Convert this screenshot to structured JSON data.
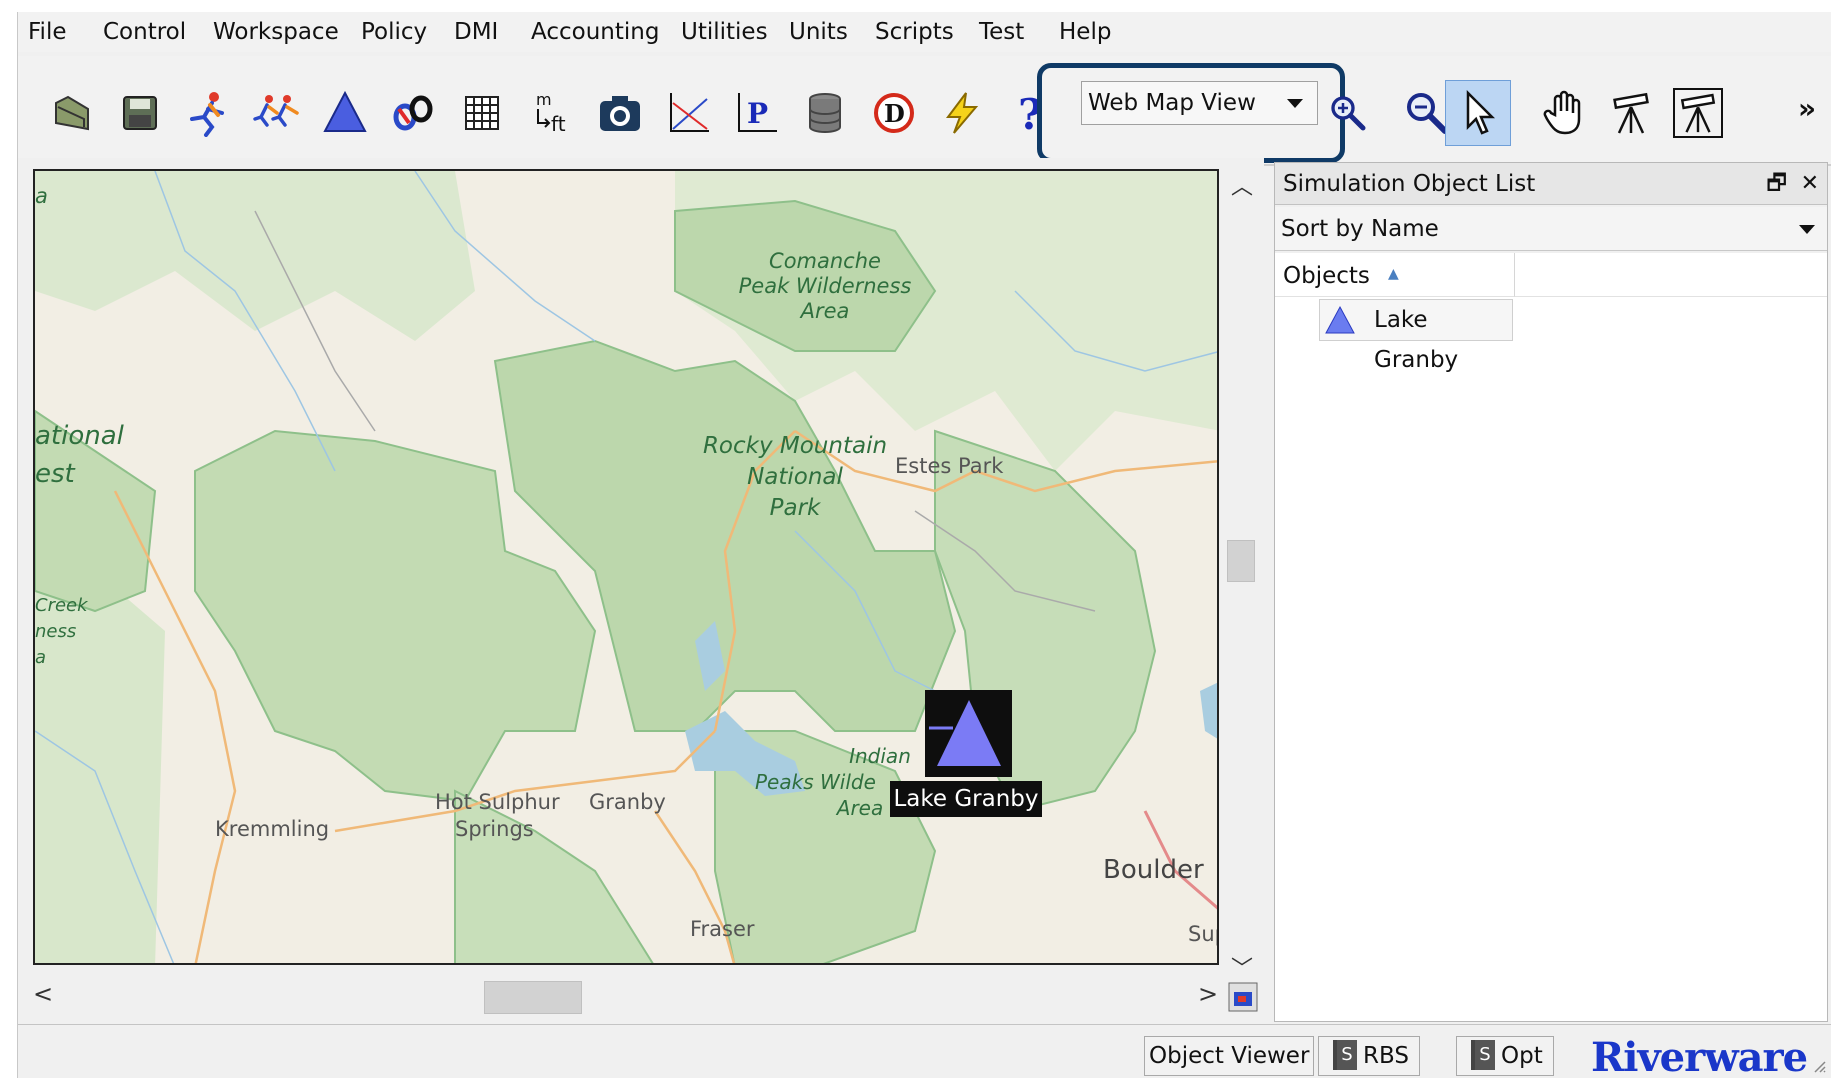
{
  "menubar": {
    "items": [
      "File",
      "Control",
      "Workspace",
      "Policy",
      "DMI",
      "Accounting",
      "Utilities",
      "Units",
      "Scripts",
      "Test",
      "Help"
    ]
  },
  "toolbar": {
    "icons": [
      "open-folder-icon",
      "save-icon",
      "run-icon",
      "run-multiple-icon",
      "reservoir-triangle-icon",
      "link-icon",
      "grid-table-icon",
      "unit-conversion-icon",
      "camera-icon",
      "plot-icon",
      "policy-p-icon",
      "database-icon",
      "dmi-d-icon",
      "lightning-icon",
      "help-question-icon",
      "zoom-in-icon",
      "zoom-out-icon",
      "select-arrow-icon",
      "pan-hand-icon",
      "survey-tripod-icon",
      "framed-tripod-icon"
    ],
    "unit_label_top": "m",
    "unit_label_bottom": "ft",
    "policy_glyph": "P",
    "dmi_glyph": "D",
    "help_glyph": "?",
    "view_select": "Web Map View",
    "overflow": "»"
  },
  "map": {
    "labels": {
      "top_left_fragment": "a",
      "wilderness_1": "Comanche",
      "wilderness_2": "Peak Wilderness",
      "wilderness_3": "Area",
      "forest_1": "ational",
      "forest_2": "est",
      "park_1": "Rocky Mountain",
      "park_2": "National",
      "park_3": "Park",
      "estes_park": "Estes Park",
      "creek_1": "Creek",
      "creek_2": "ness",
      "creek_3": "a",
      "indian_1": "Indian",
      "indian_2": "Peaks Wilde",
      "indian_3": "Area",
      "hot_sulphur_1": "Hot Sulphur",
      "hot_sulphur_2": "Springs",
      "granby": "Granby",
      "kremmling": "Kremmling",
      "boulder": "Boulder",
      "fraser": "Fraser",
      "sup": "Sup"
    },
    "node": {
      "label": "Lake Granby",
      "color": "#7b7bf5"
    }
  },
  "sim_panel": {
    "title": "Simulation Object List",
    "restore": "🗗",
    "close": "✕",
    "sort": "Sort by Name",
    "column": "Objects",
    "objects": [
      "Lake Granby"
    ]
  },
  "statusbar": {
    "object_viewer": "Object Viewer",
    "rbs": "RBS",
    "opt": "Opt",
    "logo": "Riverware"
  }
}
